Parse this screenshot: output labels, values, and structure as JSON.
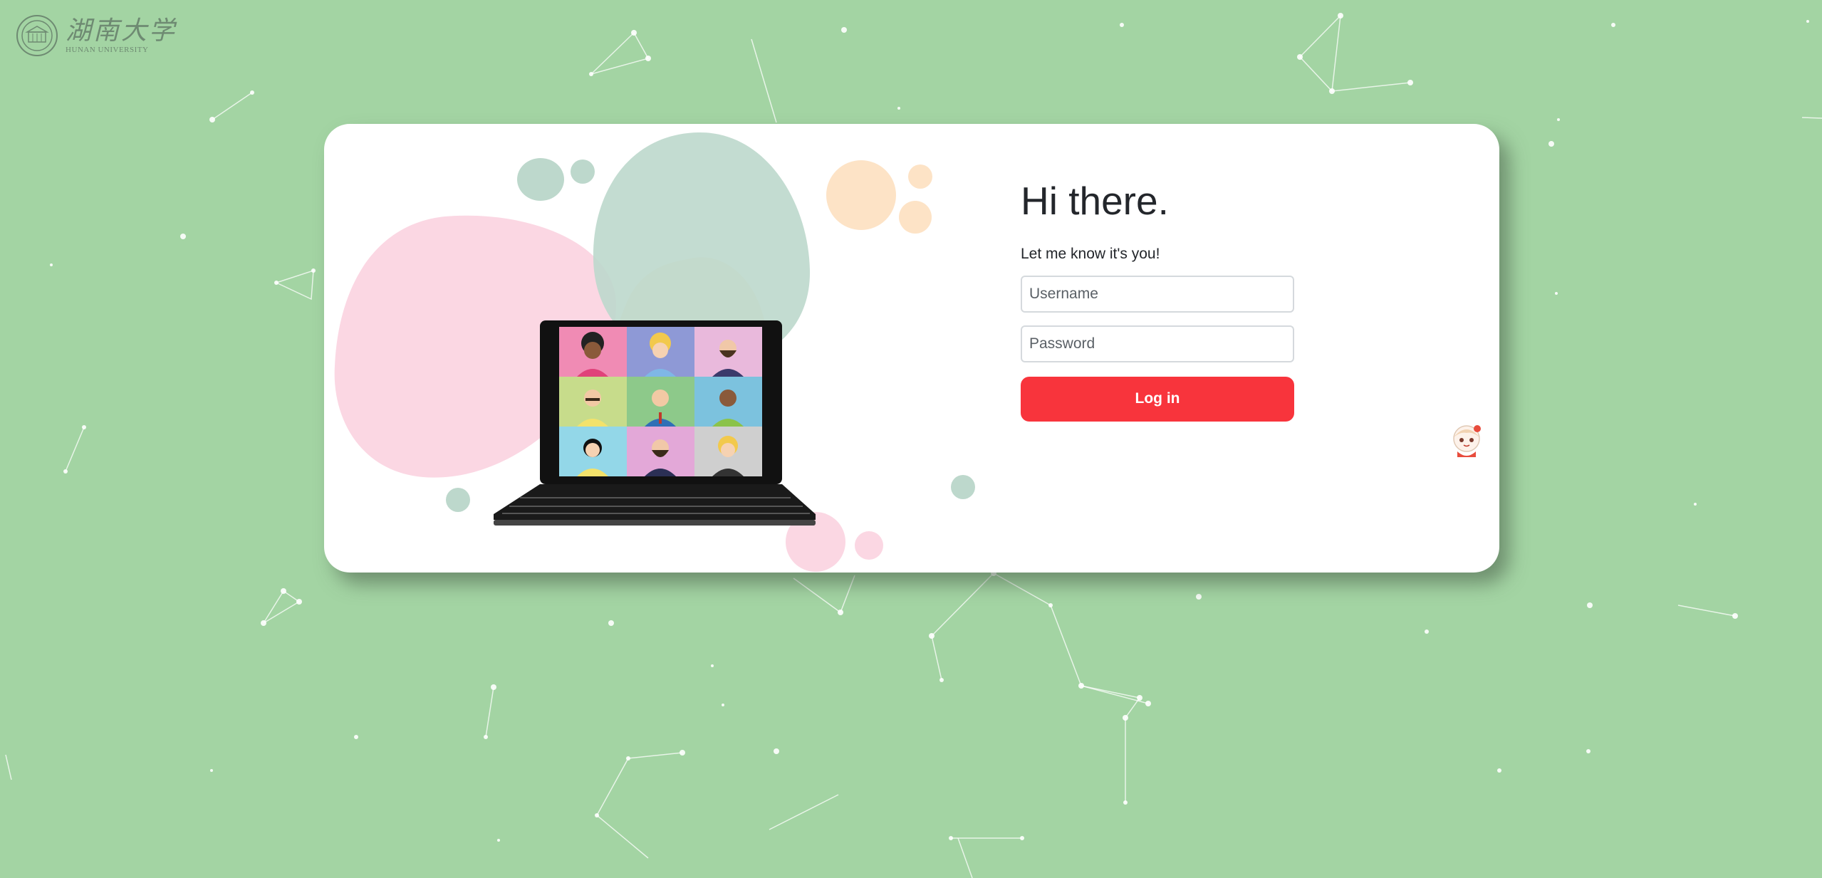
{
  "logo": {
    "chinese_name": "湖南大学",
    "english_name": "HUNAN UNIVERSITY",
    "seal_icon": "university-seal-icon"
  },
  "login": {
    "title": "Hi there.",
    "subtitle": "Let me know it's you!",
    "username_placeholder": "Username",
    "password_placeholder": "Password",
    "login_button": "Log in"
  },
  "illustration": {
    "icon": "video-conference-laptop-illustration",
    "participants": 9
  },
  "mascot": {
    "icon": "chibi-mascot-icon"
  },
  "colors": {
    "background": "#a3d4a3",
    "card": "#ffffff",
    "accent": "#f8343c",
    "blob_pink": "#fbd7e3",
    "blob_sage": "#bdd8cc",
    "blob_peach": "#fde3c6"
  }
}
